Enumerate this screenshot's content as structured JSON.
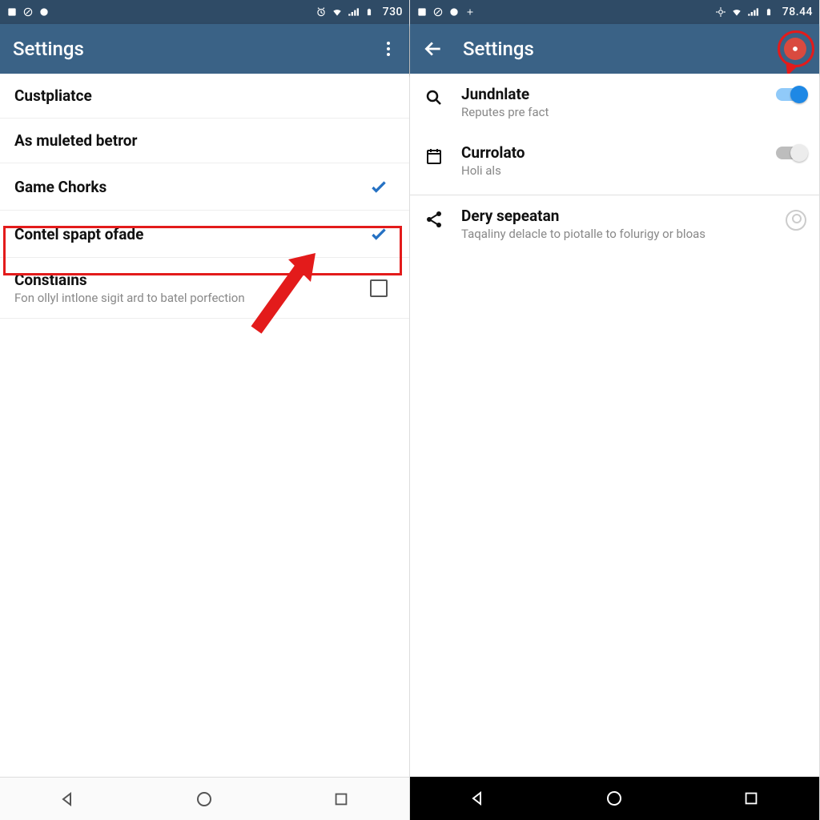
{
  "colors": {
    "status_bg": "#2f4b66",
    "appbar_bg": "#3a6286",
    "highlight": "#e31b1b",
    "accent_blue": "#2571c3"
  },
  "left": {
    "status": {
      "time": "730"
    },
    "appbar": {
      "title": "Settings"
    },
    "rows": [
      {
        "primary": "Custpliatce"
      },
      {
        "primary": "As muleted betror"
      },
      {
        "primary": "Game Chorks",
        "checked": true
      },
      {
        "primary": "Contel spapt ofade",
        "checked": true,
        "highlighted": true
      },
      {
        "primary": "Constiains",
        "secondary": "Fon ollyl intlone sigit ard to batel porfection",
        "checkbox": true
      }
    ]
  },
  "right": {
    "status": {
      "time": "78.44"
    },
    "appbar": {
      "title": "Settings"
    },
    "rows": [
      {
        "icon": "search",
        "primary": "Jundnlate",
        "secondary": "Reputes pre fact",
        "toggle": "on"
      },
      {
        "icon": "calendar",
        "primary": "Currolato",
        "secondary": "Holi als",
        "toggle": "off"
      },
      {
        "icon": "share",
        "primary": "Dery sepeatan",
        "secondary": "Taqaliny delacle to piotalle to folurigy or bloas",
        "faded_trailing": true
      }
    ]
  }
}
